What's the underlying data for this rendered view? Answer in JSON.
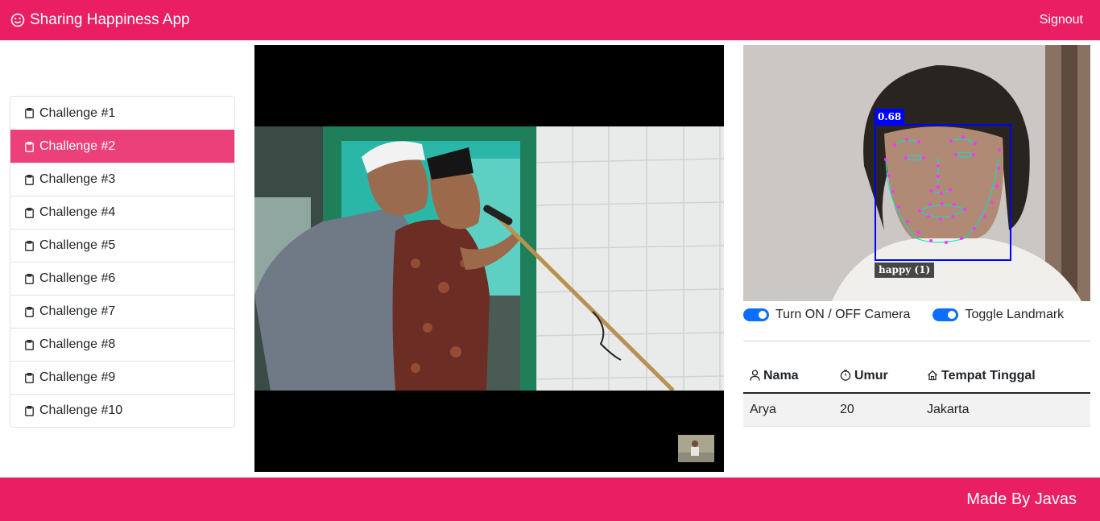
{
  "navbar": {
    "brand": "Sharing Happiness App",
    "brand_icon": "smile-icon",
    "signout": "Signout"
  },
  "challenges": {
    "active_index": 1,
    "items": [
      {
        "label": "Challenge #1"
      },
      {
        "label": "Challenge #2"
      },
      {
        "label": "Challenge #3"
      },
      {
        "label": "Challenge #4"
      },
      {
        "label": "Challenge #5"
      },
      {
        "label": "Challenge #6"
      },
      {
        "label": "Challenge #7"
      },
      {
        "label": "Challenge #8"
      },
      {
        "label": "Challenge #9"
      },
      {
        "label": "Challenge #10"
      }
    ]
  },
  "detection": {
    "score": "0.68",
    "emotion": "happy (1)"
  },
  "toggles": {
    "camera_label": "Turn ON / OFF Camera",
    "landmark_label": "Toggle Landmark"
  },
  "table": {
    "headers": {
      "name": "Nama",
      "age": "Umur",
      "city": "Tempat Tinggal"
    },
    "row": {
      "name": "Arya",
      "age": "20",
      "city": "Jakarta"
    }
  },
  "footer": {
    "text": "Made By Javas"
  },
  "colors": {
    "primary": "#e91e63",
    "active_item": "#ec407a",
    "switch": "#0d6efd",
    "bbox": "#0000ff"
  }
}
